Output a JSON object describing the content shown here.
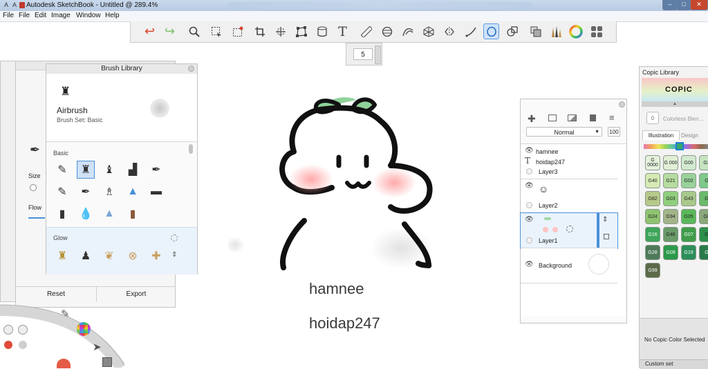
{
  "window": {
    "title": "Autodesk SketchBook - Untitled @ 289.4%",
    "tb_left": "A",
    "tb_right": "A",
    "min": "–",
    "max": "□",
    "close": "✕"
  },
  "menu": [
    "File",
    "File",
    "Edit",
    "Image",
    "Window",
    "Help"
  ],
  "toolbar": {
    "tools": [
      "undo",
      "redo",
      "zoom",
      "select",
      "crop-select",
      "crop",
      "transform",
      "distort",
      "fill",
      "text",
      "ruler",
      "ellipse",
      "curve",
      "perspective",
      "symmetry",
      "stroke",
      "lasso",
      "shape",
      "copy",
      "brushes",
      "color-wheel",
      "palette"
    ],
    "active_tool": "lasso",
    "size_value": "5"
  },
  "canvas": {
    "label1": "hamnee",
    "label2": "hoidap247"
  },
  "brush_library": {
    "title": "Brush Library",
    "brush_name": "Airbrush",
    "brush_set": "Brush Set: Basic",
    "section_basic": "Basic",
    "section_glow": "Glow",
    "reset": "Reset",
    "export": "Export"
  },
  "brush_props": {
    "size_label": "Size",
    "flow_label": "Flow"
  },
  "layers": {
    "blend_mode": "Normal",
    "opacity": "100",
    "items": [
      {
        "name": "hamnee",
        "type": "text"
      },
      {
        "name": "hoidap247",
        "type": "text"
      },
      {
        "name": "Layer3",
        "type": "layer"
      },
      {
        "name": "Layer2",
        "type": "layer"
      },
      {
        "name": "Layer1",
        "type": "layer"
      },
      {
        "name": "Background",
        "type": "background"
      }
    ]
  },
  "copic": {
    "title": "Copic Library",
    "logo": "COPIC",
    "colorless": "Colorless Blen...",
    "colorless_code": "0",
    "tab_illustration": "Illustration",
    "tab_design": "Design",
    "colors": [
      {
        "code": "G 0000",
        "hex": "#e6f2dd"
      },
      {
        "code": "G 000",
        "hex": "#e1efd6"
      },
      {
        "code": "G00",
        "hex": "#d3ead0"
      },
      {
        "code": "G2",
        "hex": "#c6e4c0"
      },
      {
        "code": "G40",
        "hex": "#d6ebb4"
      },
      {
        "code": "G21",
        "hex": "#b6dca0"
      },
      {
        "code": "G02",
        "hex": "#99d29a"
      },
      {
        "code": "G",
        "hex": "#7fc98b"
      },
      {
        "code": "G82",
        "hex": "#b7c98a"
      },
      {
        "code": "G03",
        "hex": "#8fcf7c"
      },
      {
        "code": "G43",
        "hex": "#a9c98a"
      },
      {
        "code": "G",
        "hex": "#6ab96a"
      },
      {
        "code": "G24",
        "hex": "#8fc36f"
      },
      {
        "code": "G94",
        "hex": "#a3b48a"
      },
      {
        "code": "G05",
        "hex": "#5ab85a"
      },
      {
        "code": "G8",
        "hex": "#8aa87a"
      },
      {
        "code": "G16",
        "hex": "#3ea55a"
      },
      {
        "code": "G46",
        "hex": "#6a9a6a"
      },
      {
        "code": "G07",
        "hex": "#3f9d4a"
      },
      {
        "code": "G",
        "hex": "#2f8f4a"
      },
      {
        "code": "G28",
        "hex": "#4f7a5a"
      },
      {
        "code": "G09",
        "hex": "#2c9a4a"
      },
      {
        "code": "G19",
        "hex": "#2c8f5a"
      },
      {
        "code": "G",
        "hex": "#2a7a4a"
      },
      {
        "code": "G99",
        "hex": "#5c6a4a"
      }
    ],
    "no_color": "No Copic Color Selected",
    "custom_set": "Custom set"
  },
  "accent": "#4a90d9"
}
